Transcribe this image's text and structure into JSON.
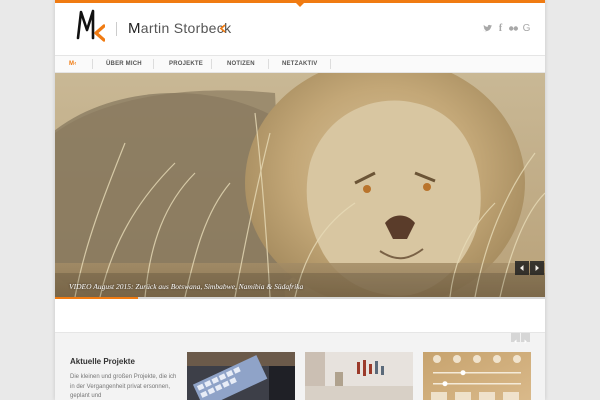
{
  "colors": {
    "accent": "#f07b12",
    "text": "#555555",
    "background": "#e9e9e9"
  },
  "site": {
    "logo_icon": "mk-logo-icon",
    "title_first": "M",
    "title_rest": "artin Storbeck"
  },
  "social": [
    {
      "name": "twitter",
      "icon": "twitter-icon",
      "glyph": ""
    },
    {
      "name": "facebook",
      "icon": "facebook-icon",
      "glyph": "f"
    },
    {
      "name": "flickr",
      "icon": "flickr-icon",
      "glyph": ""
    },
    {
      "name": "google-plus",
      "icon": "google-icon",
      "glyph": "G"
    }
  ],
  "nav": {
    "items": [
      {
        "label": "M‹",
        "active": true
      },
      {
        "label": "ÜBER MICH",
        "active": false
      },
      {
        "label": "PROJEKTE",
        "active": false
      },
      {
        "label": "NOTIZEN",
        "active": false
      },
      {
        "label": "NETZAKTIV",
        "active": false
      }
    ]
  },
  "hero": {
    "image": "lion-in-grass",
    "caption": "VIDEO August 2015: Zurück aus Botswana, Simbabwe, Namibia & Südafrika",
    "prev_icon": "arrow-left-icon",
    "next_icon": "arrow-right-icon",
    "progress": 0.17
  },
  "projects": {
    "title": "Aktuelle Projekte",
    "description": "Die kleinen und großen Projekte, die ich in der Vergangenheit privat ersonnen, geplant und",
    "thumbnails": [
      "keyboard-photo",
      "room-photo",
      "control-center-screenshot"
    ]
  }
}
